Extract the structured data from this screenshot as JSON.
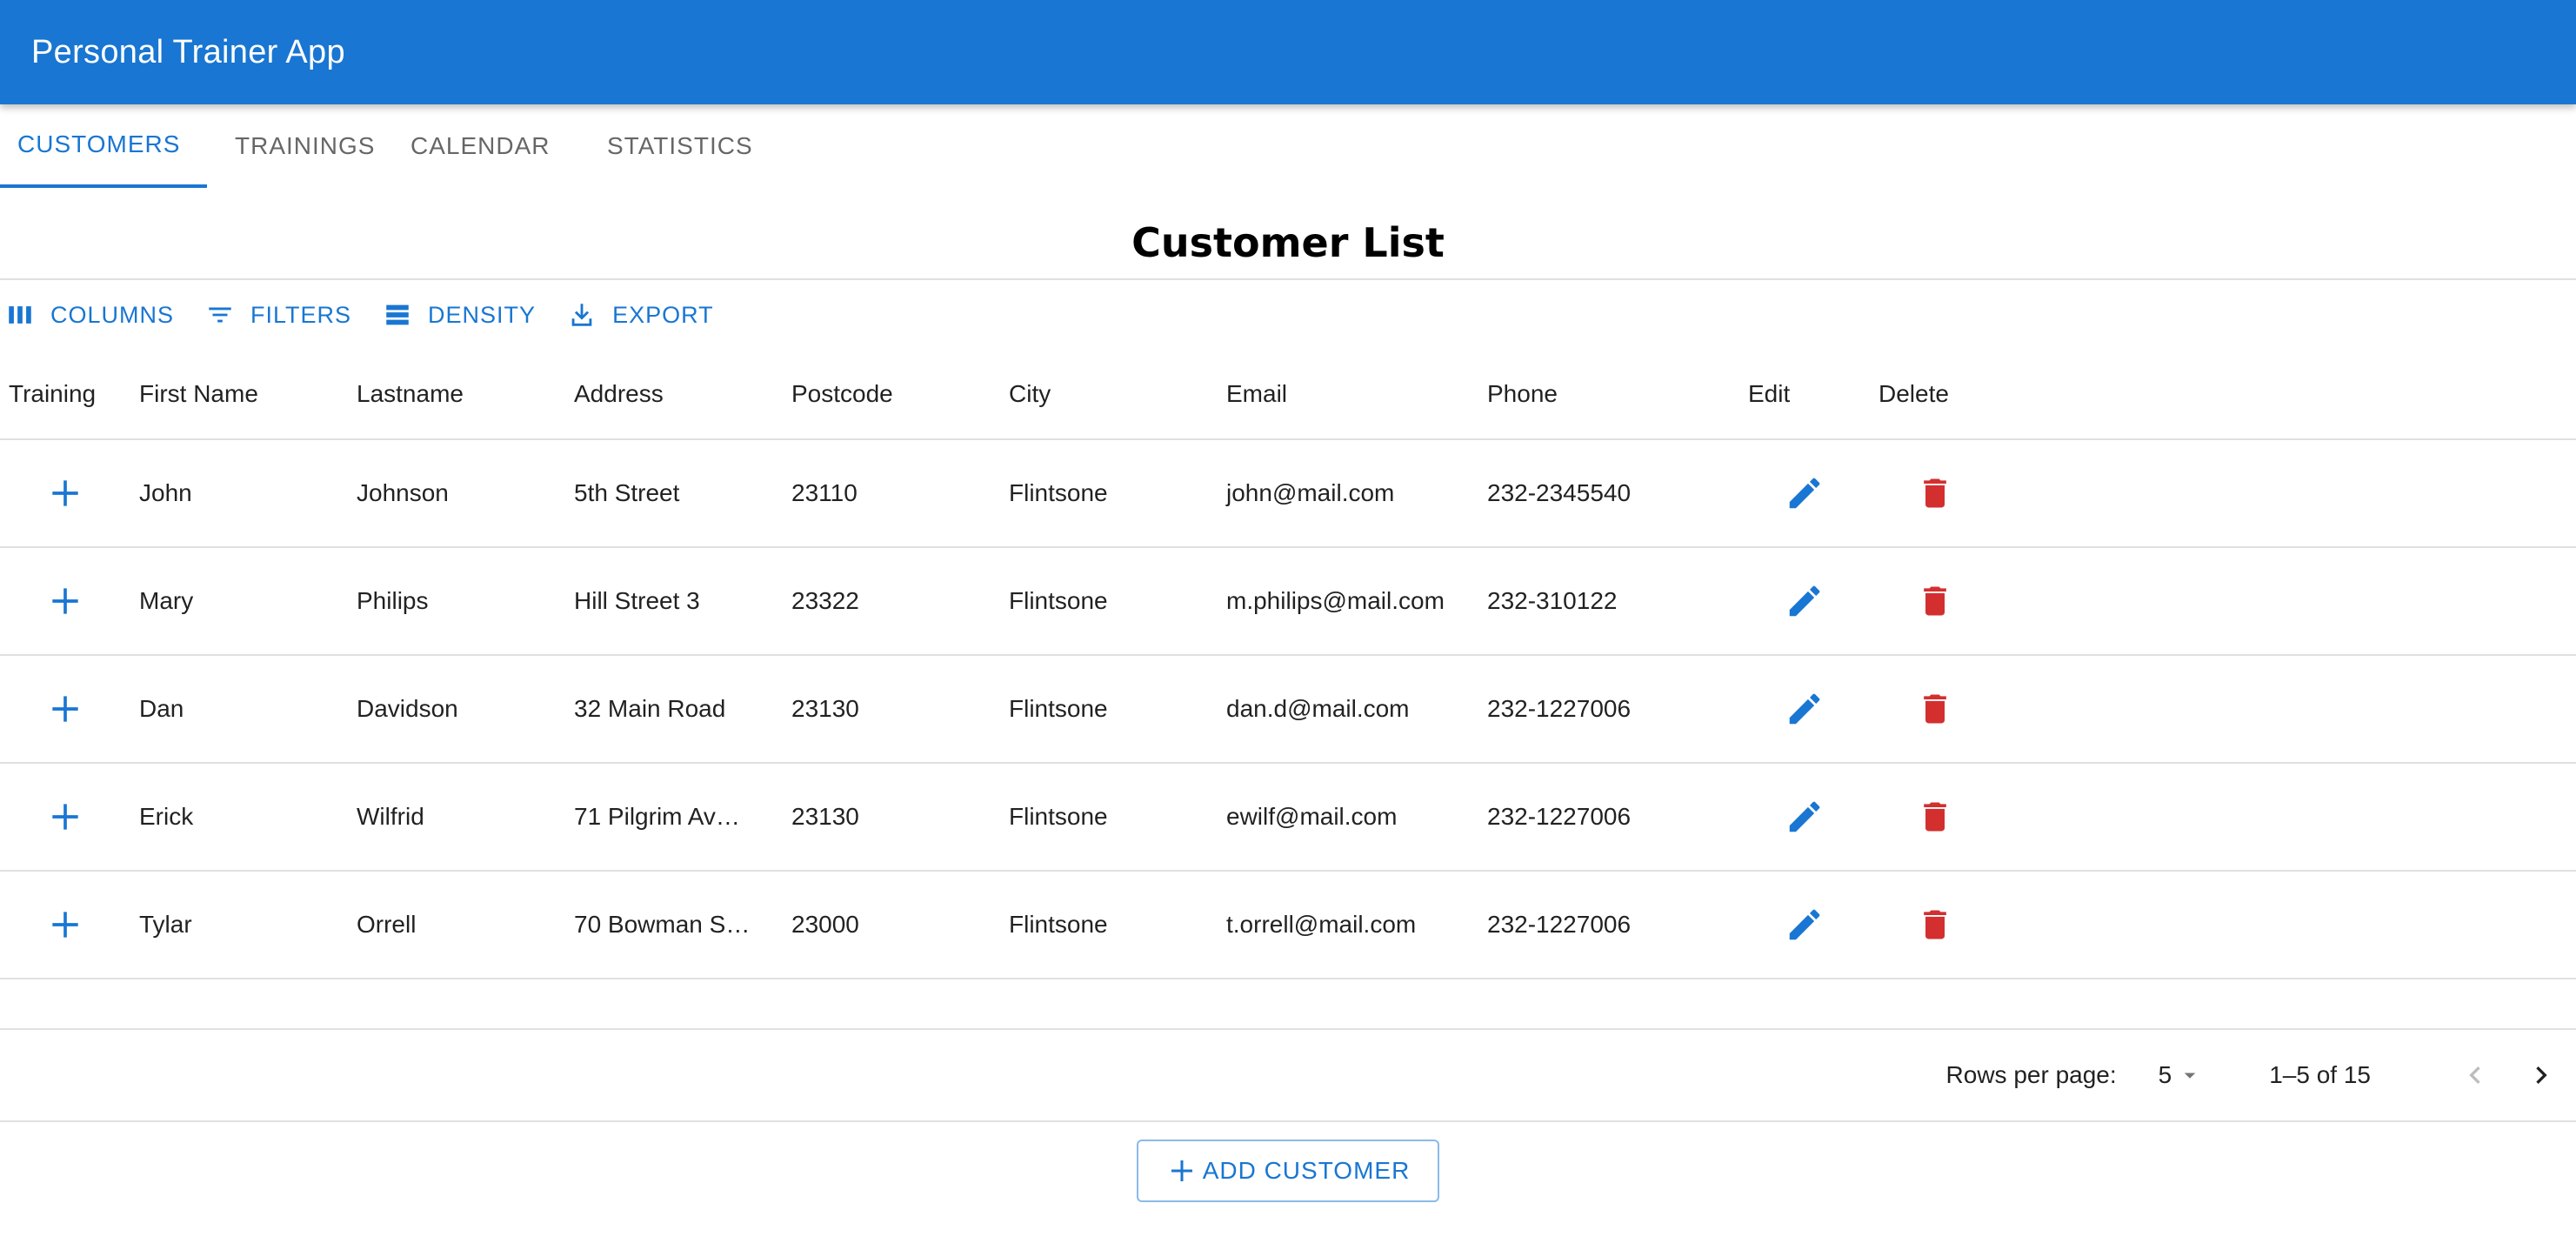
{
  "app": {
    "title": "Personal Trainer App"
  },
  "tabs": [
    {
      "label": "CUSTOMERS",
      "active": true
    },
    {
      "label": "TRAININGS",
      "active": false
    },
    {
      "label": "CALENDAR",
      "active": false
    },
    {
      "label": "STATISTICS",
      "active": false
    }
  ],
  "page": {
    "heading": "Customer List"
  },
  "toolbar": {
    "columns_label": "COLUMNS",
    "filters_label": "FILTERS",
    "density_label": "DENSITY",
    "export_label": "EXPORT"
  },
  "table": {
    "headers": [
      "Training",
      "First Name",
      "Lastname",
      "Address",
      "Postcode",
      "City",
      "Email",
      "Phone",
      "Edit",
      "Delete"
    ],
    "rows": [
      {
        "firstname": "John",
        "lastname": "Johnson",
        "address": "5th Street",
        "postcode": "23110",
        "city": "Flintsone",
        "email": "john@mail.com",
        "phone": "232-2345540"
      },
      {
        "firstname": "Mary",
        "lastname": "Philips",
        "address": "Hill Street 3",
        "postcode": "23322",
        "city": "Flintsone",
        "email": "m.philips@mail.com",
        "phone": "232-310122"
      },
      {
        "firstname": "Dan",
        "lastname": "Davidson",
        "address": "32 Main Road",
        "postcode": "23130",
        "city": "Flintsone",
        "email": "dan.d@mail.com",
        "phone": "232-1227006"
      },
      {
        "firstname": "Erick",
        "lastname": "Wilfrid",
        "address": "71 Pilgrim Av…",
        "postcode": "23130",
        "city": "Flintsone",
        "email": "ewilf@mail.com",
        "phone": "232-1227006"
      },
      {
        "firstname": "Tylar",
        "lastname": "Orrell",
        "address": "70 Bowman S…",
        "postcode": "23000",
        "city": "Flintsone",
        "email": "t.orrell@mail.com",
        "phone": "232-1227006"
      }
    ]
  },
  "pagination": {
    "rows_per_page_label": "Rows per page:",
    "rows_per_page_value": "5",
    "range_text": "1–5 of 15"
  },
  "actions": {
    "add_customer_label": "ADD CUSTOMER"
  },
  "colors": {
    "primary": "#1976d2",
    "danger": "#d32f2f"
  }
}
